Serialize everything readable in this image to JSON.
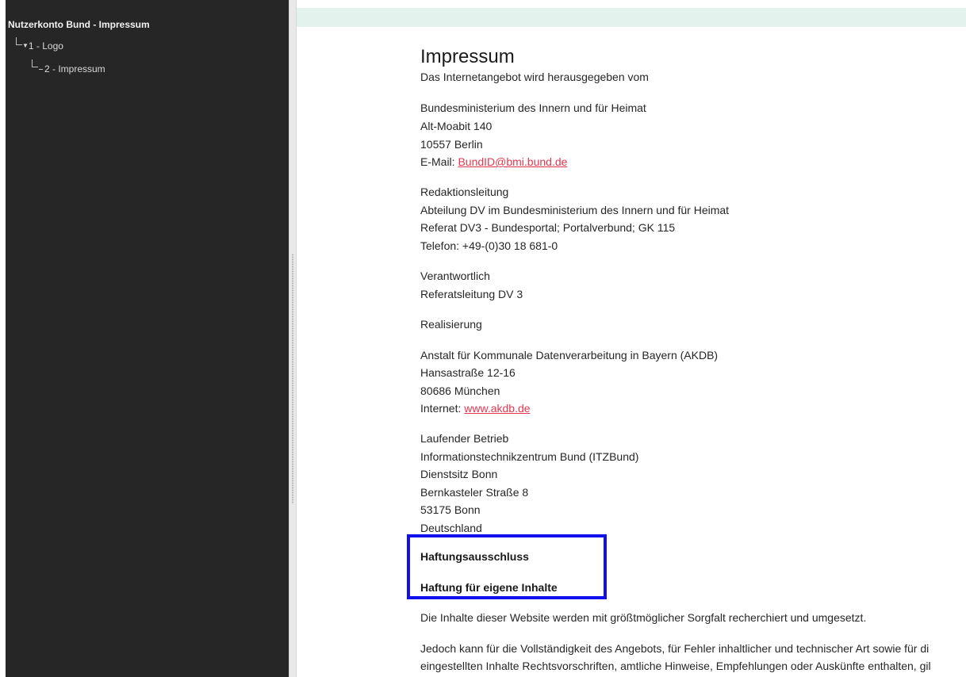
{
  "sidebar": {
    "title": "Nutzerkonto Bund - Impressum",
    "items": [
      {
        "label": "1 - Logo",
        "expand_icon": "triangle-down-icon"
      },
      {
        "label": "2 - Impressum"
      }
    ]
  },
  "content": {
    "heading": "Impressum",
    "intro": "Das Internetangebot wird herausgegeben vom",
    "publisher": {
      "name": "Bundesministerium des Innern und für Heimat",
      "street": "Alt-Moabit 140",
      "city": "10557 Berlin",
      "email_label": "E-Mail: ",
      "email": "BundID@bmi.bund.de"
    },
    "editorial": {
      "heading": "Redaktionsleitung",
      "line1": "Abteilung DV im Bundesministerium des Innern und für Heimat",
      "line2": "Referat DV3 - Bundesportal; Portalverbund; GK 115",
      "phone": "Telefon: +49-(0)30 18 681-0"
    },
    "responsible": {
      "heading": "Verantwortlich",
      "line1": "Referatsleitung DV 3"
    },
    "realization": {
      "heading": "Realisierung",
      "name": "Anstalt für Kommunale Datenverarbeitung in Bayern (AKDB)",
      "street": "Hansastraße 12-16",
      "city": "80686 München",
      "internet_label": "Internet: ",
      "internet": "www.akdb.de"
    },
    "operation": {
      "heading": "Laufender Betrieb",
      "name": "Informationstechnikzentrum Bund (ITZBund)",
      "seat": "Dienstsitz Bonn",
      "street": "Bernkasteler Straße 8",
      "city": "53175 Bonn",
      "country": "Deutschland"
    },
    "disclaimer": {
      "heading": "Haftungsausschluss",
      "subheading": "Haftung für eigene Inhalte",
      "p1": "Die Inhalte dieser Website werden mit größtmöglicher Sorgfalt recherchiert und umgesetzt.",
      "p2_line1": "Jedoch kann für die Vollständigkeit des Angebots, für Fehler inhaltlicher und technischer Art sowie für di",
      "p2_line2": "eingestellten Inhalte Rechtsvorschriften, amtliche Hinweise, Empfehlungen oder Auskünfte enthalten, gil"
    }
  },
  "colors": {
    "sidebar_bg": "#262626",
    "link": "#e2384f",
    "highlight": "#1111ee",
    "top_bar": "#e4f2ee"
  }
}
